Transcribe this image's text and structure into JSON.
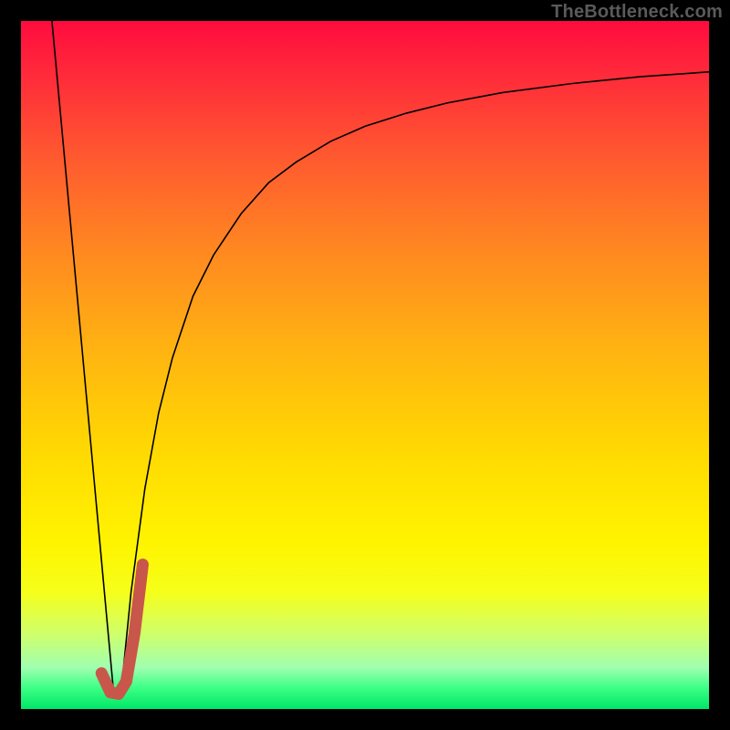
{
  "watermark": "TheBottleneck.com",
  "chart_data": {
    "type": "line",
    "title": "",
    "xlabel": "",
    "ylabel": "",
    "xlim": [
      0,
      100
    ],
    "ylim": [
      0,
      100
    ],
    "grid": false,
    "legend": false,
    "series": [
      {
        "name": "left-line",
        "x": [
          4.5,
          13.5
        ],
        "values": [
          100,
          2
        ],
        "stroke": "#000000",
        "width": 1.6
      },
      {
        "name": "right-curve",
        "x": [
          14.5,
          16,
          18,
          20,
          22,
          25,
          28,
          32,
          36,
          40,
          45,
          50,
          56,
          62,
          70,
          80,
          90,
          100
        ],
        "values": [
          2,
          17,
          32,
          43,
          51,
          60,
          66,
          72,
          76.5,
          79.5,
          82.5,
          84.7,
          86.6,
          88.1,
          89.6,
          90.9,
          91.9,
          92.6
        ],
        "stroke": "#000000",
        "width": 1.6
      },
      {
        "name": "accent-hook",
        "x": [
          11.7,
          13.0,
          14.2,
          15.3,
          16.5,
          17.7
        ],
        "values": [
          5.2,
          2.4,
          2.2,
          4.0,
          11.0,
          21.0
        ],
        "stroke": "#c9564a",
        "width": 13,
        "linecap": "round"
      }
    ]
  }
}
